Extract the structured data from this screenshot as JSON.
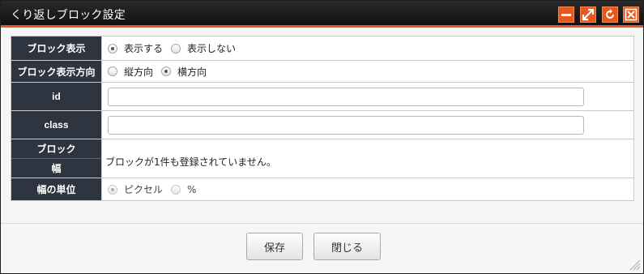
{
  "dialog": {
    "title": "くり返しブロック設定"
  },
  "window_controls": {
    "minimize": "minimize-icon",
    "maximize": "maximize-icon",
    "refresh": "refresh-icon",
    "close": "close-icon",
    "accent": "#e8581c"
  },
  "form": {
    "display": {
      "label": "ブロック表示",
      "options": [
        "表示する",
        "表示しない"
      ],
      "selected": "表示する"
    },
    "direction": {
      "label": "ブロック表示方向",
      "options": [
        "縦方向",
        "横方向"
      ],
      "selected": "横方向"
    },
    "id": {
      "label": "id",
      "value": ""
    },
    "class": {
      "label": "class",
      "value": ""
    },
    "block_width": {
      "label_top": "ブロック",
      "label_bottom": "幅",
      "message": "ブロックが1件も登録されていません。"
    },
    "width_unit": {
      "label": "幅の単位",
      "options": [
        "ピクセル",
        "%"
      ],
      "selected": "ピクセル",
      "disabled": true
    }
  },
  "buttons": {
    "save": "保存",
    "close": "閉じる"
  }
}
